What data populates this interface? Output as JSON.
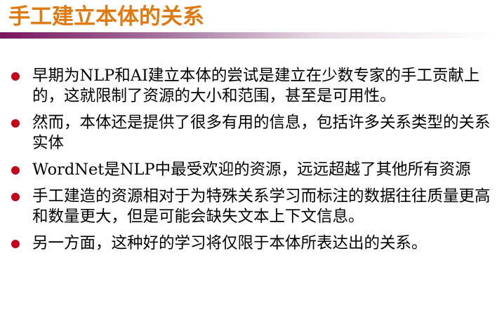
{
  "slide": {
    "title": "手工建立本体的关系",
    "accent_color": "#e07a10",
    "bullet_color": "#c4001b",
    "bar_color": "#7a1560",
    "bullets": [
      {
        "text": "早期为NLP和AI建立本体的尝试是建立在少数专家的手工贡献上的，这就限制了资源的大小和范围，甚至是可用性。"
      },
      {
        "text": "然而，本体还是提供了很多有用的信息，包括许多关系类型的关系实体"
      },
      {
        "text": "WordNet是NLP中最受欢迎的资源，远远超越了其他所有资源"
      },
      {
        "text": "手工建造的资源相对于为特殊关系学习而标注的数据往往质量更高和数量更大，但是可能会缺失文本上下文信息。"
      },
      {
        "text": "另一方面，这种好的学习将仅限于本体所表达出的关系。"
      }
    ]
  }
}
